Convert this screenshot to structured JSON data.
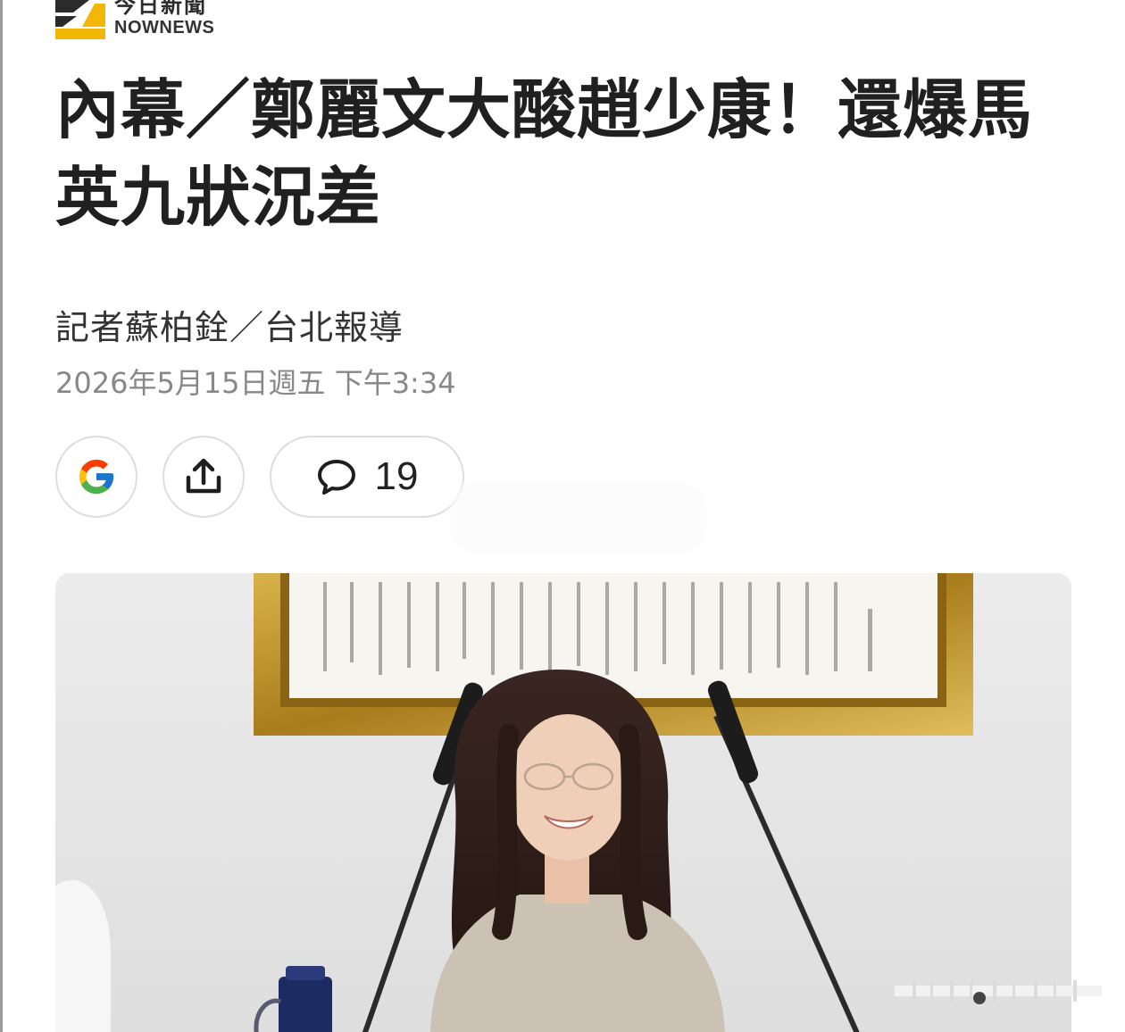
{
  "brand": {
    "name_cn": "今日新聞",
    "name_en": "NOWNEWS"
  },
  "article": {
    "headline": "內幕／鄭麗文大酸趙少康！還爆馬英九狀況差",
    "byline": "記者蘇柏銓／台北報導",
    "datetime": "2026年5月15日週五 下午3:34"
  },
  "actions": {
    "google_icon": "google-g-icon",
    "share_icon": "share-upload-icon",
    "comment_icon": "speech-bubble-icon",
    "comment_count": "19"
  },
  "colors": {
    "brand_yellow": "#f2b705",
    "headline": "#202020",
    "meta": "#888888",
    "frame_gold": "#b8902a"
  }
}
